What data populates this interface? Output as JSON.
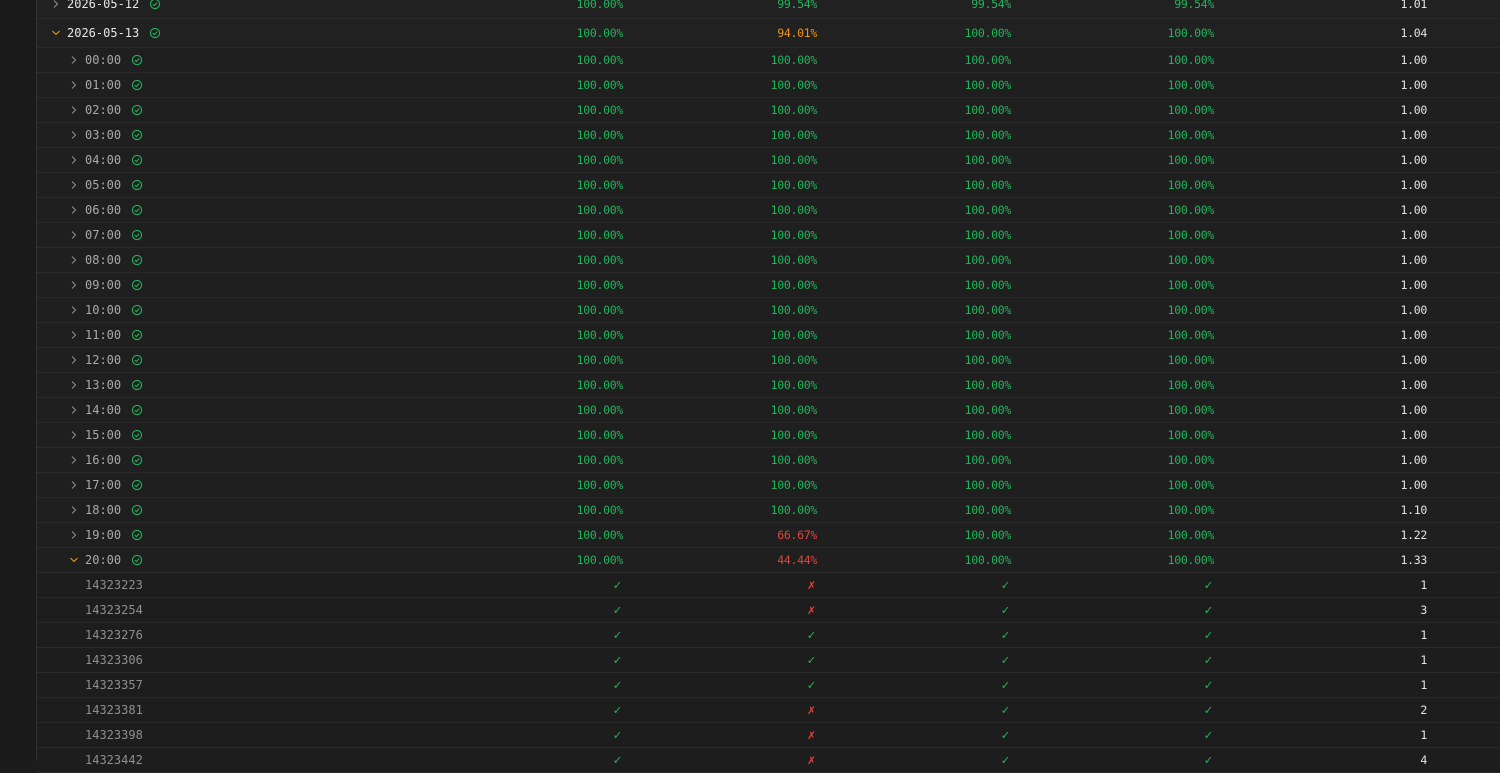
{
  "colors": {
    "green": "#22b35a",
    "amber": "#e8961c",
    "red": "#e0443c"
  },
  "rows": [
    {
      "kind": "day",
      "label": "2026-05-12",
      "expanded": false,
      "icon": "check-circle-icon",
      "cells": [
        {
          "v": "100.00%",
          "c": "green"
        },
        {
          "v": "99.54%",
          "c": "green"
        },
        {
          "v": "99.54%",
          "c": "green"
        },
        {
          "v": "99.54%",
          "c": "green"
        },
        {
          "v": "1.01",
          "c": "plain"
        }
      ]
    },
    {
      "kind": "day",
      "label": "2026-05-13",
      "expanded": true,
      "icon": "check-circle-icon",
      "cells": [
        {
          "v": "100.00%",
          "c": "green"
        },
        {
          "v": "94.01%",
          "c": "amber"
        },
        {
          "v": "100.00%",
          "c": "green"
        },
        {
          "v": "100.00%",
          "c": "green"
        },
        {
          "v": "1.04",
          "c": "plain"
        }
      ]
    },
    {
      "kind": "hour",
      "label": "00:00",
      "expanded": false,
      "icon": "check-circle-icon",
      "cells": [
        {
          "v": "100.00%",
          "c": "green"
        },
        {
          "v": "100.00%",
          "c": "green"
        },
        {
          "v": "100.00%",
          "c": "green"
        },
        {
          "v": "100.00%",
          "c": "green"
        },
        {
          "v": "1.00",
          "c": "plain"
        }
      ]
    },
    {
      "kind": "hour",
      "label": "01:00",
      "expanded": false,
      "icon": "check-circle-icon",
      "cells": [
        {
          "v": "100.00%",
          "c": "green"
        },
        {
          "v": "100.00%",
          "c": "green"
        },
        {
          "v": "100.00%",
          "c": "green"
        },
        {
          "v": "100.00%",
          "c": "green"
        },
        {
          "v": "1.00",
          "c": "plain"
        }
      ]
    },
    {
      "kind": "hour",
      "label": "02:00",
      "expanded": false,
      "icon": "check-circle-icon",
      "cells": [
        {
          "v": "100.00%",
          "c": "green"
        },
        {
          "v": "100.00%",
          "c": "green"
        },
        {
          "v": "100.00%",
          "c": "green"
        },
        {
          "v": "100.00%",
          "c": "green"
        },
        {
          "v": "1.00",
          "c": "plain"
        }
      ]
    },
    {
      "kind": "hour",
      "label": "03:00",
      "expanded": false,
      "icon": "check-circle-icon",
      "cells": [
        {
          "v": "100.00%",
          "c": "green"
        },
        {
          "v": "100.00%",
          "c": "green"
        },
        {
          "v": "100.00%",
          "c": "green"
        },
        {
          "v": "100.00%",
          "c": "green"
        },
        {
          "v": "1.00",
          "c": "plain"
        }
      ]
    },
    {
      "kind": "hour",
      "label": "04:00",
      "expanded": false,
      "icon": "check-circle-icon",
      "cells": [
        {
          "v": "100.00%",
          "c": "green"
        },
        {
          "v": "100.00%",
          "c": "green"
        },
        {
          "v": "100.00%",
          "c": "green"
        },
        {
          "v": "100.00%",
          "c": "green"
        },
        {
          "v": "1.00",
          "c": "plain"
        }
      ]
    },
    {
      "kind": "hour",
      "label": "05:00",
      "expanded": false,
      "icon": "check-circle-icon",
      "cells": [
        {
          "v": "100.00%",
          "c": "green"
        },
        {
          "v": "100.00%",
          "c": "green"
        },
        {
          "v": "100.00%",
          "c": "green"
        },
        {
          "v": "100.00%",
          "c": "green"
        },
        {
          "v": "1.00",
          "c": "plain"
        }
      ]
    },
    {
      "kind": "hour",
      "label": "06:00",
      "expanded": false,
      "icon": "check-circle-icon",
      "cells": [
        {
          "v": "100.00%",
          "c": "green"
        },
        {
          "v": "100.00%",
          "c": "green"
        },
        {
          "v": "100.00%",
          "c": "green"
        },
        {
          "v": "100.00%",
          "c": "green"
        },
        {
          "v": "1.00",
          "c": "plain"
        }
      ]
    },
    {
      "kind": "hour",
      "label": "07:00",
      "expanded": false,
      "icon": "check-circle-icon",
      "cells": [
        {
          "v": "100.00%",
          "c": "green"
        },
        {
          "v": "100.00%",
          "c": "green"
        },
        {
          "v": "100.00%",
          "c": "green"
        },
        {
          "v": "100.00%",
          "c": "green"
        },
        {
          "v": "1.00",
          "c": "plain"
        }
      ]
    },
    {
      "kind": "hour",
      "label": "08:00",
      "expanded": false,
      "icon": "check-circle-icon",
      "cells": [
        {
          "v": "100.00%",
          "c": "green"
        },
        {
          "v": "100.00%",
          "c": "green"
        },
        {
          "v": "100.00%",
          "c": "green"
        },
        {
          "v": "100.00%",
          "c": "green"
        },
        {
          "v": "1.00",
          "c": "plain"
        }
      ]
    },
    {
      "kind": "hour",
      "label": "09:00",
      "expanded": false,
      "icon": "check-circle-icon",
      "cells": [
        {
          "v": "100.00%",
          "c": "green"
        },
        {
          "v": "100.00%",
          "c": "green"
        },
        {
          "v": "100.00%",
          "c": "green"
        },
        {
          "v": "100.00%",
          "c": "green"
        },
        {
          "v": "1.00",
          "c": "plain"
        }
      ]
    },
    {
      "kind": "hour",
      "label": "10:00",
      "expanded": false,
      "icon": "check-circle-icon",
      "cells": [
        {
          "v": "100.00%",
          "c": "green"
        },
        {
          "v": "100.00%",
          "c": "green"
        },
        {
          "v": "100.00%",
          "c": "green"
        },
        {
          "v": "100.00%",
          "c": "green"
        },
        {
          "v": "1.00",
          "c": "plain"
        }
      ]
    },
    {
      "kind": "hour",
      "label": "11:00",
      "expanded": false,
      "icon": "check-circle-icon",
      "cells": [
        {
          "v": "100.00%",
          "c": "green"
        },
        {
          "v": "100.00%",
          "c": "green"
        },
        {
          "v": "100.00%",
          "c": "green"
        },
        {
          "v": "100.00%",
          "c": "green"
        },
        {
          "v": "1.00",
          "c": "plain"
        }
      ]
    },
    {
      "kind": "hour",
      "label": "12:00",
      "expanded": false,
      "icon": "check-circle-icon",
      "cells": [
        {
          "v": "100.00%",
          "c": "green"
        },
        {
          "v": "100.00%",
          "c": "green"
        },
        {
          "v": "100.00%",
          "c": "green"
        },
        {
          "v": "100.00%",
          "c": "green"
        },
        {
          "v": "1.00",
          "c": "plain"
        }
      ]
    },
    {
      "kind": "hour",
      "label": "13:00",
      "expanded": false,
      "icon": "check-circle-icon",
      "cells": [
        {
          "v": "100.00%",
          "c": "green"
        },
        {
          "v": "100.00%",
          "c": "green"
        },
        {
          "v": "100.00%",
          "c": "green"
        },
        {
          "v": "100.00%",
          "c": "green"
        },
        {
          "v": "1.00",
          "c": "plain"
        }
      ]
    },
    {
      "kind": "hour",
      "label": "14:00",
      "expanded": false,
      "icon": "check-circle-icon",
      "cells": [
        {
          "v": "100.00%",
          "c": "green"
        },
        {
          "v": "100.00%",
          "c": "green"
        },
        {
          "v": "100.00%",
          "c": "green"
        },
        {
          "v": "100.00%",
          "c": "green"
        },
        {
          "v": "1.00",
          "c": "plain"
        }
      ]
    },
    {
      "kind": "hour",
      "label": "15:00",
      "expanded": false,
      "icon": "check-circle-icon",
      "cells": [
        {
          "v": "100.00%",
          "c": "green"
        },
        {
          "v": "100.00%",
          "c": "green"
        },
        {
          "v": "100.00%",
          "c": "green"
        },
        {
          "v": "100.00%",
          "c": "green"
        },
        {
          "v": "1.00",
          "c": "plain"
        }
      ]
    },
    {
      "kind": "hour",
      "label": "16:00",
      "expanded": false,
      "icon": "check-circle-icon",
      "cells": [
        {
          "v": "100.00%",
          "c": "green"
        },
        {
          "v": "100.00%",
          "c": "green"
        },
        {
          "v": "100.00%",
          "c": "green"
        },
        {
          "v": "100.00%",
          "c": "green"
        },
        {
          "v": "1.00",
          "c": "plain"
        }
      ]
    },
    {
      "kind": "hour",
      "label": "17:00",
      "expanded": false,
      "icon": "check-circle-icon",
      "cells": [
        {
          "v": "100.00%",
          "c": "green"
        },
        {
          "v": "100.00%",
          "c": "green"
        },
        {
          "v": "100.00%",
          "c": "green"
        },
        {
          "v": "100.00%",
          "c": "green"
        },
        {
          "v": "1.00",
          "c": "plain"
        }
      ]
    },
    {
      "kind": "hour",
      "label": "18:00",
      "expanded": false,
      "icon": "check-circle-icon",
      "cells": [
        {
          "v": "100.00%",
          "c": "green"
        },
        {
          "v": "100.00%",
          "c": "green"
        },
        {
          "v": "100.00%",
          "c": "green"
        },
        {
          "v": "100.00%",
          "c": "green"
        },
        {
          "v": "1.10",
          "c": "plain"
        }
      ]
    },
    {
      "kind": "hour",
      "label": "19:00",
      "expanded": false,
      "icon": "check-circle-icon",
      "cells": [
        {
          "v": "100.00%",
          "c": "green"
        },
        {
          "v": "66.67%",
          "c": "red"
        },
        {
          "v": "100.00%",
          "c": "green"
        },
        {
          "v": "100.00%",
          "c": "green"
        },
        {
          "v": "1.22",
          "c": "plain"
        }
      ]
    },
    {
      "kind": "hour",
      "label": "20:00",
      "expanded": true,
      "icon": "check-circle-icon",
      "cells": [
        {
          "v": "100.00%",
          "c": "green"
        },
        {
          "v": "44.44%",
          "c": "red"
        },
        {
          "v": "100.00%",
          "c": "green"
        },
        {
          "v": "100.00%",
          "c": "green"
        },
        {
          "v": "1.33",
          "c": "plain"
        }
      ]
    },
    {
      "kind": "id",
      "label": "14323223",
      "cells": [
        {
          "v": "✓",
          "c": "green"
        },
        {
          "v": "✗",
          "c": "red"
        },
        {
          "v": "✓",
          "c": "green"
        },
        {
          "v": "✓",
          "c": "green"
        },
        {
          "v": "1",
          "c": "plain"
        }
      ]
    },
    {
      "kind": "id",
      "label": "14323254",
      "cells": [
        {
          "v": "✓",
          "c": "green"
        },
        {
          "v": "✗",
          "c": "red"
        },
        {
          "v": "✓",
          "c": "green"
        },
        {
          "v": "✓",
          "c": "green"
        },
        {
          "v": "3",
          "c": "plain"
        }
      ]
    },
    {
      "kind": "id",
      "label": "14323276",
      "cells": [
        {
          "v": "✓",
          "c": "green"
        },
        {
          "v": "✓",
          "c": "green"
        },
        {
          "v": "✓",
          "c": "green"
        },
        {
          "v": "✓",
          "c": "green"
        },
        {
          "v": "1",
          "c": "plain"
        }
      ]
    },
    {
      "kind": "id",
      "label": "14323306",
      "cells": [
        {
          "v": "✓",
          "c": "green"
        },
        {
          "v": "✓",
          "c": "green"
        },
        {
          "v": "✓",
          "c": "green"
        },
        {
          "v": "✓",
          "c": "green"
        },
        {
          "v": "1",
          "c": "plain"
        }
      ]
    },
    {
      "kind": "id",
      "label": "14323357",
      "cells": [
        {
          "v": "✓",
          "c": "green"
        },
        {
          "v": "✓",
          "c": "green"
        },
        {
          "v": "✓",
          "c": "green"
        },
        {
          "v": "✓",
          "c": "green"
        },
        {
          "v": "1",
          "c": "plain"
        }
      ]
    },
    {
      "kind": "id",
      "label": "14323381",
      "cells": [
        {
          "v": "✓",
          "c": "green"
        },
        {
          "v": "✗",
          "c": "red"
        },
        {
          "v": "✓",
          "c": "green"
        },
        {
          "v": "✓",
          "c": "green"
        },
        {
          "v": "2",
          "c": "plain"
        }
      ]
    },
    {
      "kind": "id",
      "label": "14323398",
      "cells": [
        {
          "v": "✓",
          "c": "green"
        },
        {
          "v": "✗",
          "c": "red"
        },
        {
          "v": "✓",
          "c": "green"
        },
        {
          "v": "✓",
          "c": "green"
        },
        {
          "v": "1",
          "c": "plain"
        }
      ]
    },
    {
      "kind": "id",
      "label": "14323442",
      "cells": [
        {
          "v": "✓",
          "c": "green"
        },
        {
          "v": "✗",
          "c": "red"
        },
        {
          "v": "✓",
          "c": "green"
        },
        {
          "v": "✓",
          "c": "green"
        },
        {
          "v": "4",
          "c": "plain"
        }
      ]
    }
  ]
}
